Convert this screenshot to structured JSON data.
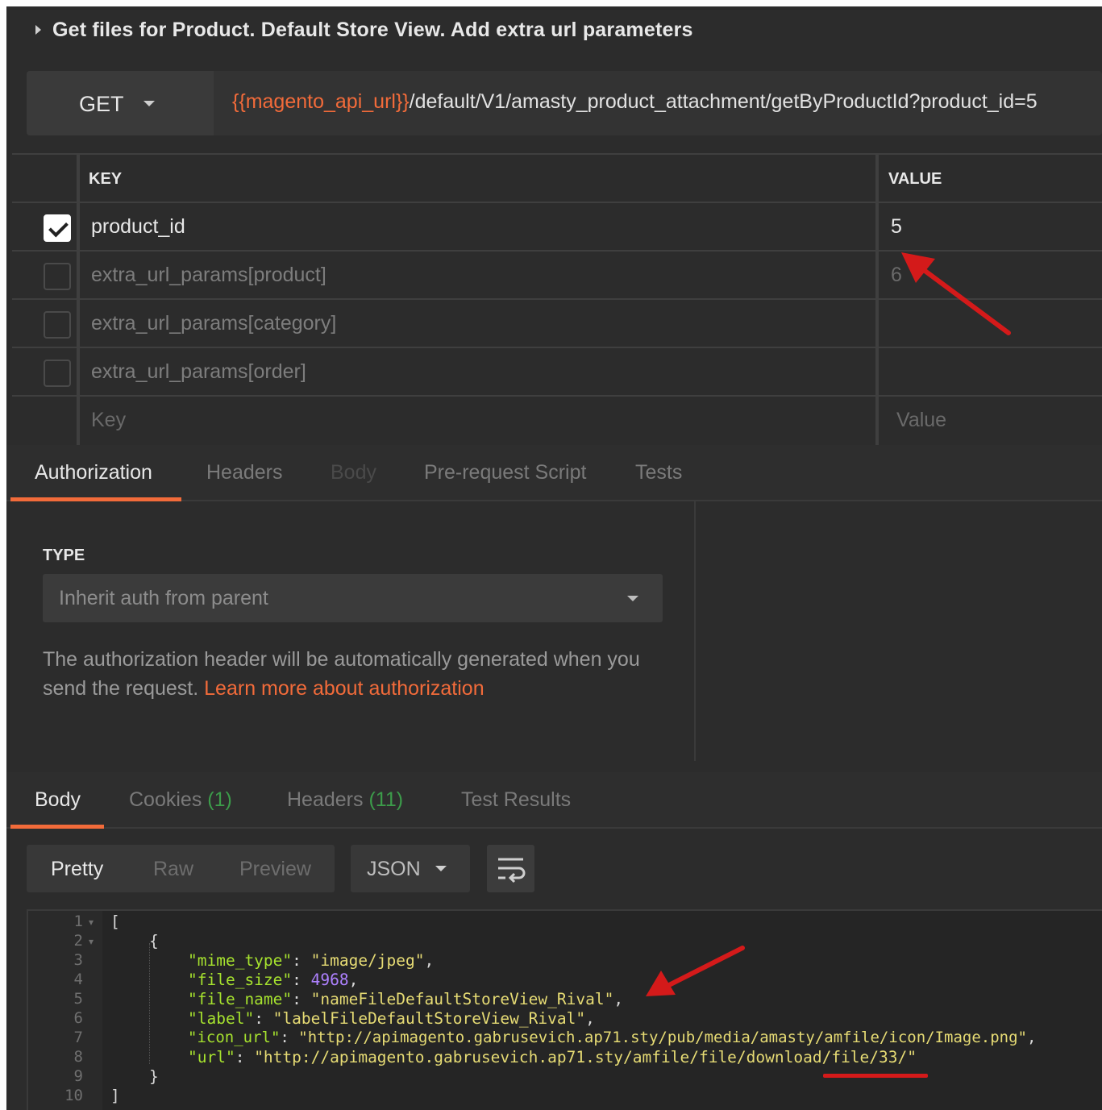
{
  "request": {
    "title": "Get files for Product. Default Store View. Add extra url parameters",
    "method": "GET",
    "url_variable": "{{magento_api_url}}",
    "url_path": "/default/V1/amasty_product_attachment/getByProductId?product_id=5"
  },
  "params": {
    "key_header": "KEY",
    "value_header": "VALUE",
    "rows": [
      {
        "key": "product_id",
        "value": "5",
        "checked": true
      },
      {
        "key": "extra_url_params[product]",
        "value": "6",
        "checked": false
      },
      {
        "key": "extra_url_params[category]",
        "value": "",
        "checked": false
      },
      {
        "key": "extra_url_params[order]",
        "value": "",
        "checked": false
      }
    ],
    "key_placeholder": "Key",
    "value_placeholder": "Value"
  },
  "request_tabs": [
    "Authorization",
    "Headers",
    "Body",
    "Pre-request Script",
    "Tests"
  ],
  "auth": {
    "type_label": "TYPE",
    "type_value": "Inherit auth from parent",
    "description": "The authorization header will be automatically generated when you send the request.",
    "link_text": "Learn more about authorization"
  },
  "response_tabs": {
    "body": "Body",
    "cookies": "Cookies",
    "cookies_count": "(1)",
    "headers": "Headers",
    "headers_count": "(11)",
    "test_results": "Test Results"
  },
  "response_toolbar": {
    "views": [
      "Pretty",
      "Raw",
      "Preview"
    ],
    "format": "JSON"
  },
  "code_lines": {
    "numbers": [
      "1",
      "2",
      "3",
      "4",
      "5",
      "6",
      "7",
      "8",
      "9",
      "10"
    ],
    "l1": "[",
    "l2": "{",
    "mime_key": "\"mime_type\"",
    "mime_val": "\"image/jpeg\"",
    "size_key": "\"file_size\"",
    "size_val": "4968",
    "name_key": "\"file_name\"",
    "name_val": "\"nameFileDefaultStoreView_Rival\"",
    "label_key": "\"label\"",
    "label_val": "\"labelFileDefaultStoreView_Rival\"",
    "icon_key": "\"icon_url\"",
    "icon_val": "\"http://apimagento.gabrusevich.ap71.sty/pub/media/amasty/amfile/icon/Image.png\"",
    "url_key": "\"url\"",
    "url_val": "\"http://apimagento.gabrusevich.ap71.sty/amfile/file/download/file/33/\"",
    "l9": "}",
    "l10": "]"
  },
  "colors": {
    "accent": "#f26b3a",
    "annotation_red": "#d41a1a",
    "count_green": "#3c9b4a"
  }
}
